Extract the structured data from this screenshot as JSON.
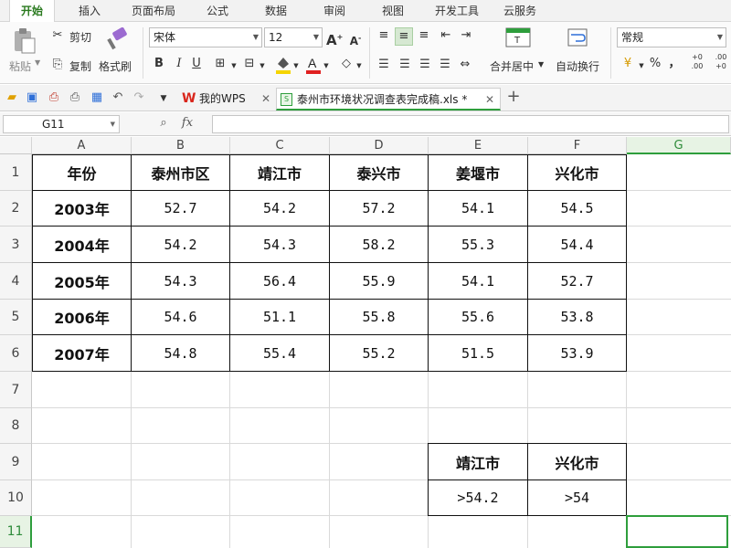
{
  "menu": {
    "tabs": [
      {
        "label": "开始",
        "active": true
      },
      {
        "label": "插入"
      },
      {
        "label": "页面布局"
      },
      {
        "label": "公式"
      },
      {
        "label": "数据"
      },
      {
        "label": "审阅"
      },
      {
        "label": "视图"
      },
      {
        "label": "开发工具"
      },
      {
        "label": "云服务"
      }
    ]
  },
  "ribbon": {
    "paste_label": "粘贴",
    "cut_label": "剪切",
    "copy_label": "复制",
    "format_painter_label": "格式刷",
    "font_name": "宋体",
    "font_size": "12",
    "bold": "B",
    "italic": "I",
    "underline": "U",
    "merge_center_label": "合并居中",
    "wrap_text_label": "自动换行",
    "number_format": "常规",
    "percent": "%",
    "comma": "，",
    "inc_decimal": "+0 .00",
    "dec_decimal": ".00 +0"
  },
  "tabs_bar": {
    "wps_tab": "我的WPS",
    "doc_tab": "泰州市环境状况调查表完成稿.xls *",
    "add_tab": "+"
  },
  "formula_bar": {
    "cell_ref": "G11",
    "fx": "fx",
    "value": ""
  },
  "sheet": {
    "columns": [
      "A",
      "B",
      "C",
      "D",
      "E",
      "F",
      "G"
    ],
    "selected_column": "G",
    "rows": [
      "1",
      "2",
      "3",
      "4",
      "5",
      "6",
      "7",
      "8",
      "9",
      "10",
      "11"
    ],
    "selected_row": "11",
    "table": {
      "headers": [
        "年份",
        "泰州市区",
        "靖江市",
        "泰兴市",
        "姜堰市",
        "兴化市"
      ],
      "data": [
        [
          "2003年",
          "52.7",
          "54.2",
          "57.2",
          "54.1",
          "54.5"
        ],
        [
          "2004年",
          "54.2",
          "54.3",
          "58.2",
          "55.3",
          "54.4"
        ],
        [
          "2005年",
          "54.3",
          "56.4",
          "55.9",
          "54.1",
          "52.7"
        ],
        [
          "2006年",
          "54.6",
          "51.1",
          "55.8",
          "55.6",
          "53.8"
        ],
        [
          "2007年",
          "54.8",
          "55.4",
          "55.2",
          "51.5",
          "53.9"
        ]
      ]
    },
    "criteria": {
      "headers": [
        "靖江市",
        "兴化市"
      ],
      "values": [
        ">54.2",
        ">54"
      ]
    }
  },
  "colors": {
    "accent": "#2e9e3c",
    "active_tab_text": "#2a7a1f"
  }
}
